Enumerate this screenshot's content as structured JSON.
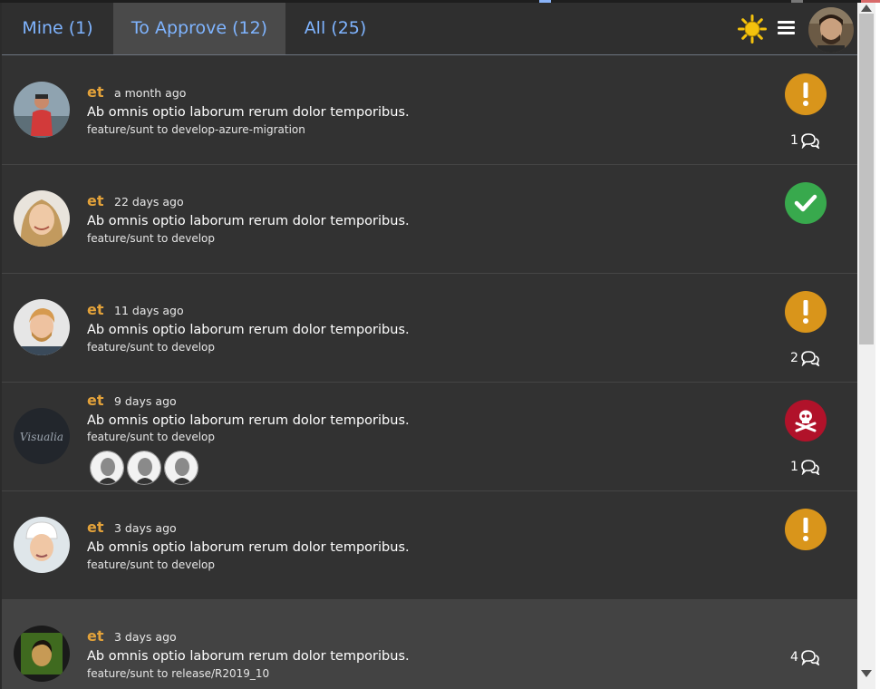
{
  "tabs": [
    {
      "label": "Mine (1)"
    },
    {
      "label": "To Approve (12)",
      "active": true
    },
    {
      "label": "All (25)"
    }
  ],
  "toolbar": {
    "theme_icon": "sun-icon",
    "menu_icon": "hamburger-menu-icon",
    "user_avatar": "current-user-avatar"
  },
  "colors": {
    "tab_text": "#7fb4ff",
    "author": "#e3a23a",
    "warning": "#d9951b",
    "approved": "#38a94d",
    "rejected": "#b1122a"
  },
  "pull_requests": [
    {
      "author": "et",
      "time": "a month ago",
      "title": "Ab omnis optio laborum rerum dolor temporibus.",
      "branch": "feature/sunt to develop-azure-migration",
      "status": "warning",
      "comments": "1"
    },
    {
      "author": "et",
      "time": "22 days ago",
      "title": "Ab omnis optio laborum rerum dolor temporibus.",
      "branch": "feature/sunt to develop",
      "status": "approved"
    },
    {
      "author": "et",
      "time": "11 days ago",
      "title": "Ab omnis optio laborum rerum dolor temporibus.",
      "branch": "feature/sunt to develop",
      "status": "warning",
      "comments": "2"
    },
    {
      "author": "et",
      "time": "9 days ago",
      "title": "Ab omnis optio laborum rerum dolor temporibus.",
      "branch": "feature/sunt to develop",
      "status": "rejected",
      "comments": "1",
      "avatar_text": "Visualia",
      "reviewers": 3
    },
    {
      "author": "et",
      "time": "3 days ago",
      "title": "Ab omnis optio laborum rerum dolor temporibus.",
      "branch": "feature/sunt to develop",
      "status": "warning"
    },
    {
      "author": "et",
      "time": "3 days ago",
      "title": "Ab omnis optio laborum rerum dolor temporibus.",
      "branch": "feature/sunt to release/R2019_10",
      "status": "none",
      "comments": "4"
    }
  ]
}
